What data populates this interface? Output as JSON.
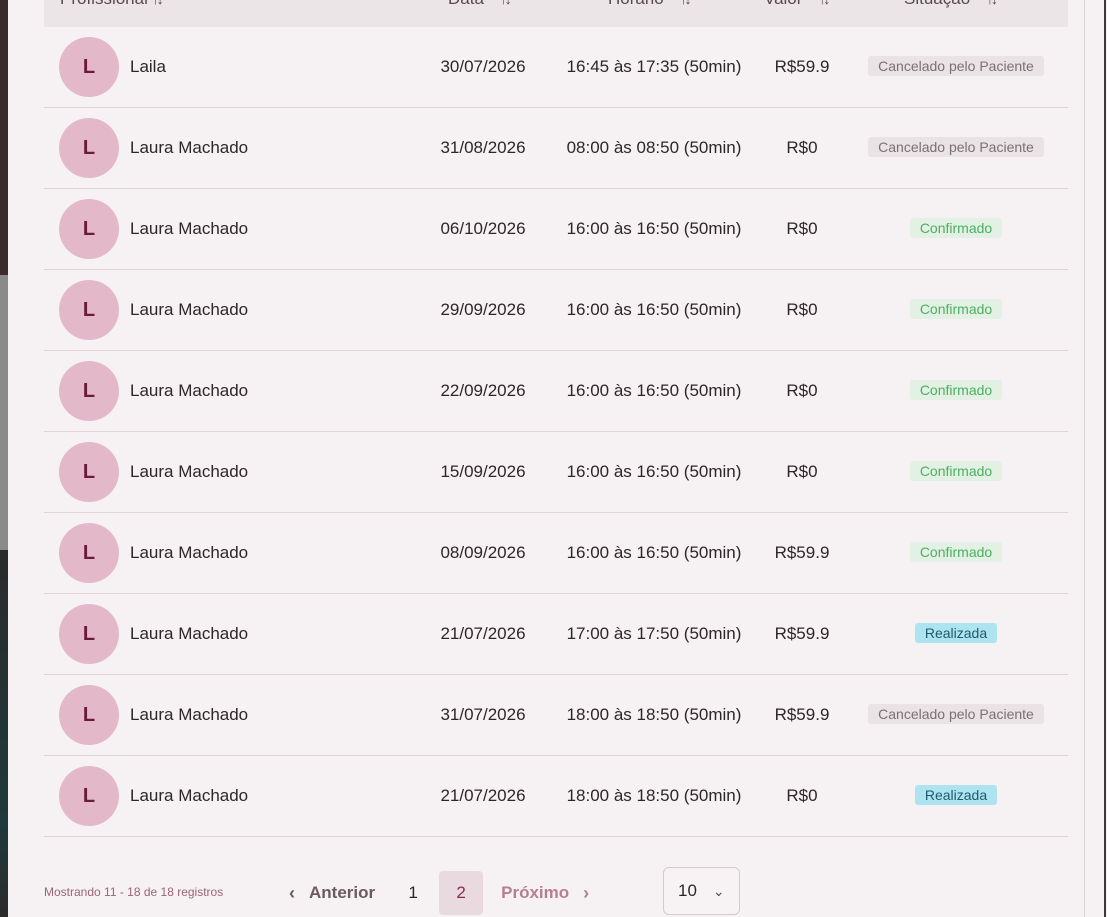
{
  "columns": {
    "professional": "Profissional",
    "date": "Data",
    "time": "Horário",
    "value": "Valor",
    "status": "Situação"
  },
  "rows": [
    {
      "initial": "L",
      "name": "Laila",
      "date": "30/07/2026",
      "time": "16:45 às 17:35 (50min)",
      "value": "R$59.9",
      "status": "Cancelado pelo Paciente",
      "status_type": "cancel"
    },
    {
      "initial": "L",
      "name": "Laura Machado",
      "date": "31/08/2026",
      "time": "08:00 às 08:50 (50min)",
      "value": "R$0",
      "status": "Cancelado pelo Paciente",
      "status_type": "cancel"
    },
    {
      "initial": "L",
      "name": "Laura Machado",
      "date": "06/10/2026",
      "time": "16:00 às 16:50 (50min)",
      "value": "R$0",
      "status": "Confirmado",
      "status_type": "confirm"
    },
    {
      "initial": "L",
      "name": "Laura Machado",
      "date": "29/09/2026",
      "time": "16:00 às 16:50 (50min)",
      "value": "R$0",
      "status": "Confirmado",
      "status_type": "confirm"
    },
    {
      "initial": "L",
      "name": "Laura Machado",
      "date": "22/09/2026",
      "time": "16:00 às 16:50 (50min)",
      "value": "R$0",
      "status": "Confirmado",
      "status_type": "confirm"
    },
    {
      "initial": "L",
      "name": "Laura Machado",
      "date": "15/09/2026",
      "time": "16:00 às 16:50 (50min)",
      "value": "R$0",
      "status": "Confirmado",
      "status_type": "confirm"
    },
    {
      "initial": "L",
      "name": "Laura Machado",
      "date": "08/09/2026",
      "time": "16:00 às 16:50 (50min)",
      "value": "R$59.9",
      "status": "Confirmado",
      "status_type": "confirm"
    },
    {
      "initial": "L",
      "name": "Laura Machado",
      "date": "21/07/2026",
      "time": "17:00 às 17:50 (50min)",
      "value": "R$59.9",
      "status": "Realizada",
      "status_type": "done"
    },
    {
      "initial": "L",
      "name": "Laura Machado",
      "date": "31/07/2026",
      "time": "18:00 às 18:50 (50min)",
      "value": "R$59.9",
      "status": "Cancelado pelo Paciente",
      "status_type": "cancel"
    },
    {
      "initial": "L",
      "name": "Laura Machado",
      "date": "21/07/2026",
      "time": "18:00 às 18:50 (50min)",
      "value": "R$0",
      "status": "Realizada",
      "status_type": "done"
    }
  ],
  "footer": {
    "records_text": "Mostrando 11 - 18 de 18 registros",
    "prev_label": "Anterior",
    "next_label": "Próximo",
    "pages": [
      "1",
      "2"
    ],
    "current_page": "2",
    "page_size": "10"
  },
  "colors": {
    "avatar_bg": "#e3b9c9",
    "avatar_text": "#6b1a3a",
    "confirm": "#4caf62",
    "done_bg": "#aee3f0",
    "accent": "#8a2a55"
  },
  "icons": {
    "sort": "sort-arrows-icon",
    "prev": "chevron-left-icon",
    "next": "chevron-right-icon",
    "dropdown": "chevron-down-icon"
  }
}
